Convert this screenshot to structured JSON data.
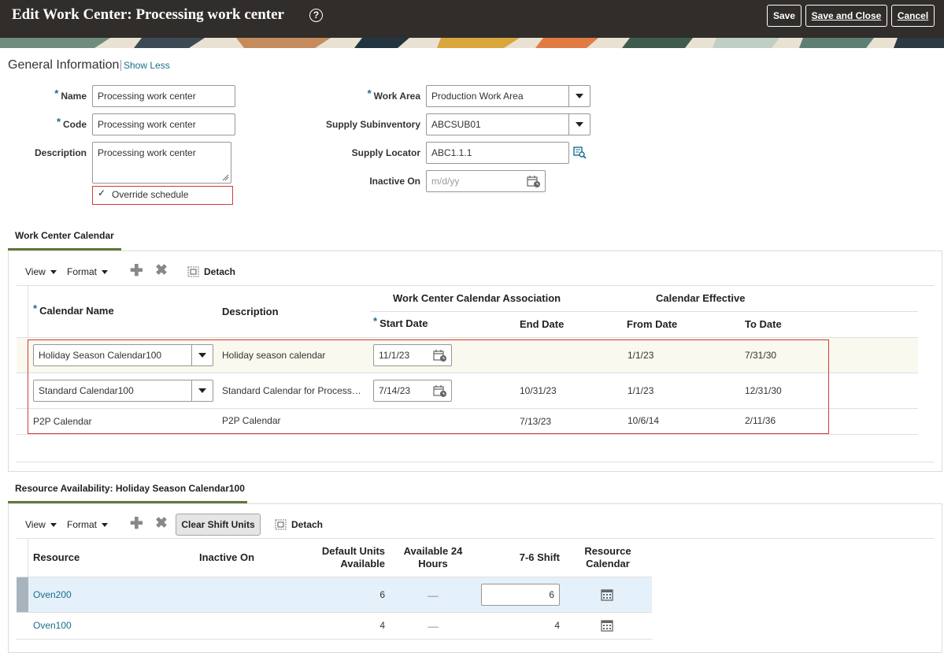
{
  "header": {
    "title": "Edit Work Center: Processing work center",
    "help_icon": "?",
    "save_label": "Save",
    "save_close_label": "Save and Close",
    "cancel_label": "Cancel"
  },
  "general": {
    "title": "General Information",
    "show_less": "Show Less",
    "name_label": "Name",
    "name_value": "Processing work center",
    "code_label": "Code",
    "code_value": "Processing work center",
    "description_label": "Description",
    "description_value": "Processing work center",
    "override_label": "Override schedule",
    "override_checked": true,
    "work_area_label": "Work Area",
    "work_area_value": "Production Work Area",
    "supply_subinventory_label": "Supply Subinventory",
    "supply_subinventory_value": "ABCSUB01",
    "supply_locator_label": "Supply Locator",
    "supply_locator_value": "ABC1.1.1",
    "inactive_on_label": "Inactive On",
    "inactive_on_placeholder": "m/d/yy",
    "required_marker": "*"
  },
  "calendar_tab": {
    "label": "Work Center Calendar",
    "toolbar": {
      "view": "View",
      "format": "Format",
      "detach": "Detach"
    },
    "group_headers": {
      "association": "Work Center Calendar Association",
      "effective": "Calendar Effective"
    },
    "columns": {
      "calendar_name": "Calendar Name",
      "description": "Description",
      "start_date": "Start Date",
      "end_date": "End Date",
      "from_date": "From Date",
      "to_date": "To Date"
    },
    "rows": [
      {
        "calendar_name": "Holiday Season Calendar100",
        "description": "Holiday season calendar",
        "start_date": "11/1/23",
        "end_date": "",
        "from_date": "1/1/23",
        "to_date": "7/31/30"
      },
      {
        "calendar_name": "Standard Calendar100",
        "description": "Standard Calendar for Processing work center",
        "start_date": "7/14/23",
        "end_date": "10/31/23",
        "from_date": "1/1/23",
        "to_date": "12/31/30"
      },
      {
        "calendar_name": "P2P Calendar",
        "description": "P2P Calendar",
        "start_date": "",
        "end_date": "7/13/23",
        "from_date": "10/6/14",
        "to_date": "2/11/36"
      }
    ]
  },
  "resource_tab": {
    "label": "Resource Availability: Holiday Season Calendar100",
    "toolbar": {
      "view": "View",
      "format": "Format",
      "clear_shift": "Clear Shift Units",
      "detach": "Detach"
    },
    "columns": {
      "resource": "Resource",
      "inactive_on": "Inactive On",
      "default_units_1": "Default Units",
      "default_units_2": "Available",
      "available24_1": "Available 24",
      "available24_2": "Hours",
      "shift": "7-6 Shift",
      "res_cal_1": "Resource",
      "res_cal_2": "Calendar"
    },
    "rows": [
      {
        "resource": "Oven200",
        "inactive_on": "",
        "default_units": "6",
        "available24": "__",
        "shift": "6"
      },
      {
        "resource": "Oven100",
        "inactive_on": "",
        "default_units": "4",
        "available24": "__",
        "shift": "4"
      }
    ]
  },
  "colors": {
    "header_bg": "#312d2a",
    "link": "#1a6e8a",
    "tab_underline": "#5e7a3a",
    "highlight_border": "#d13b3b",
    "selected_row": "#e4f0fa",
    "alt_row": "#f9f9ef"
  }
}
